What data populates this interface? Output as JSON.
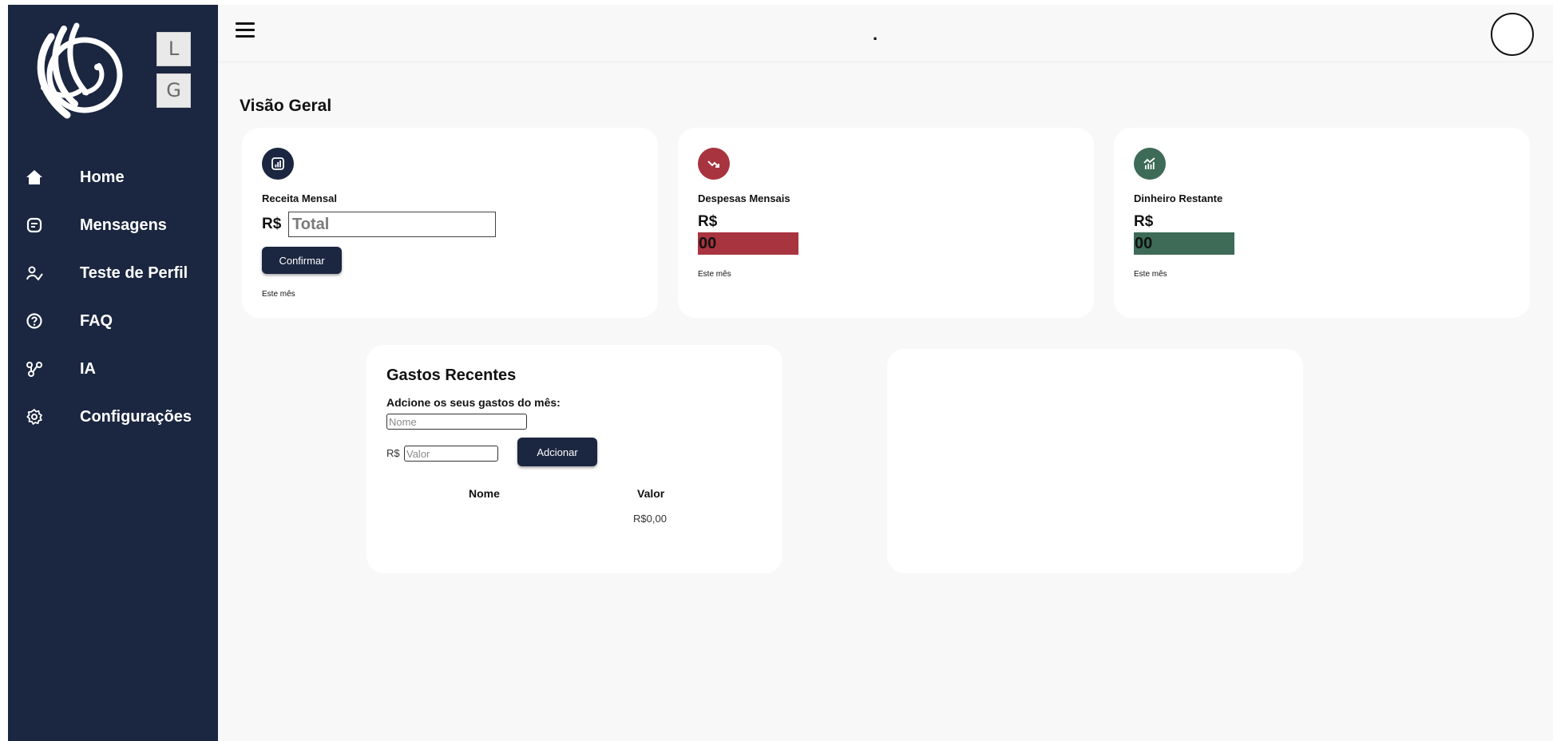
{
  "sidebar": {
    "logo_icon": "phoenix-logo",
    "lang_buttons": [
      "L",
      "G"
    ],
    "items": [
      {
        "label": "Home",
        "icon": "home-icon"
      },
      {
        "label": "Mensagens",
        "icon": "message-icon"
      },
      {
        "label": "Teste de Perfil",
        "icon": "profile-test-icon"
      },
      {
        "label": "FAQ",
        "icon": "help-icon"
      },
      {
        "label": "IA",
        "icon": "network-icon"
      },
      {
        "label": "Configurações",
        "icon": "gear-icon"
      }
    ]
  },
  "topbar": {
    "center_text": ".",
    "menu_icon": "hamburger-icon",
    "avatar_icon": "avatar"
  },
  "main": {
    "title": "Visão Geral",
    "cards": {
      "receita": {
        "label": "Receita Mensal",
        "currency": "R$",
        "input_placeholder": "Total",
        "confirm_label": "Confirmar",
        "note": "Este mês",
        "icon": "bar-chart-icon",
        "icon_color": "#1b2640"
      },
      "despesas": {
        "label": "Despesas Mensais",
        "currency": "R$",
        "value": "00",
        "note": "Este mês",
        "icon": "trend-down-icon",
        "icon_color": "#a8343f",
        "value_bg": "#a8343f"
      },
      "restante": {
        "label": "Dinheiro Restante",
        "currency": "R$",
        "value": "00",
        "note": "Este mês",
        "icon": "growth-chart-icon",
        "icon_color": "#3d6b57",
        "value_bg": "#3d6b57"
      }
    },
    "gastos": {
      "title": "Gastos Recentes",
      "subtitle": "Adcione os seus gastos do mês:",
      "name_placeholder": "Nome",
      "currency": "R$",
      "value_placeholder": "Valor",
      "add_label": "Adcionar",
      "columns": [
        "Nome",
        "Valor"
      ],
      "total": "R$0,00"
    }
  }
}
